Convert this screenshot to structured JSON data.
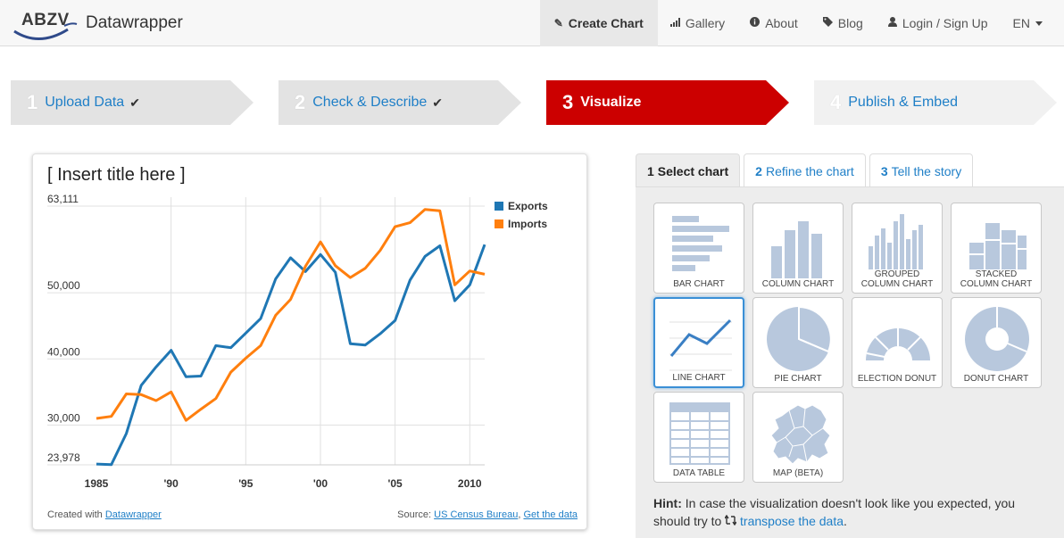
{
  "brand": {
    "logo_text": "ABZV",
    "name": "Datawrapper"
  },
  "nav": {
    "create_chart": "Create Chart",
    "gallery": "Gallery",
    "about": "About",
    "blog": "Blog",
    "login": "Login / Sign Up",
    "lang": "EN"
  },
  "steps": [
    {
      "num": "1",
      "label": "Upload Data",
      "state": "done"
    },
    {
      "num": "2",
      "label": "Check & Describe",
      "state": "done"
    },
    {
      "num": "3",
      "label": "Visualize",
      "state": "active"
    },
    {
      "num": "4",
      "label": "Publish & Embed",
      "state": "todo"
    }
  ],
  "check_mark": "✔",
  "chart": {
    "title": "[ Insert title here ]",
    "footer_prefix": "Created with",
    "footer_link": "Datawrapper",
    "source_prefix": "Source:",
    "source_link": "US Census Bureau",
    "source_sep": ",",
    "get_data": "Get the data"
  },
  "chart_data": {
    "type": "line",
    "title": "[ Insert title here ]",
    "xlabel": "",
    "ylabel": "",
    "x": [
      1985,
      1986,
      1987,
      1988,
      1989,
      1990,
      1991,
      1992,
      1993,
      1994,
      1995,
      1996,
      1997,
      1998,
      1999,
      2000,
      2001,
      2002,
      2003,
      2004,
      2005,
      2006,
      2007,
      2008,
      2009,
      2010,
      2011
    ],
    "xticks": [
      {
        "value": 1985,
        "label": "1985"
      },
      {
        "value": 1990,
        "label": "'90"
      },
      {
        "value": 1995,
        "label": "'95"
      },
      {
        "value": 2000,
        "label": "'00"
      },
      {
        "value": 2005,
        "label": "'05"
      },
      {
        "value": 2010,
        "label": "2010"
      }
    ],
    "yticks": [
      {
        "value": 63111,
        "label": "63,111"
      },
      {
        "value": 50000,
        "label": "50,000"
      },
      {
        "value": 40000,
        "label": "40,000"
      },
      {
        "value": 30000,
        "label": "30,000"
      },
      {
        "value": 23978,
        "label": "23,978"
      }
    ],
    "ylim": [
      23978,
      63111
    ],
    "xlim": [
      1985,
      2011
    ],
    "grid": true,
    "legend_position": "top-right",
    "series": [
      {
        "name": "Exports",
        "color": "#1f77b4",
        "values": [
          24100,
          24000,
          28700,
          36000,
          38800,
          41300,
          37300,
          37400,
          42000,
          41700,
          43900,
          46100,
          52100,
          55300,
          53200,
          55800,
          53100,
          42300,
          42100,
          43800,
          45800,
          51900,
          55500,
          57100,
          48800,
          51200,
          57300
        ]
      },
      {
        "name": "Imports",
        "color": "#ff7f0e",
        "values": [
          31000,
          31300,
          34700,
          34600,
          33700,
          35000,
          30700,
          32400,
          34000,
          38000,
          40100,
          42000,
          46600,
          49000,
          54000,
          57700,
          54100,
          52300,
          53700,
          56400,
          60000,
          60600,
          62600,
          62400,
          51200,
          53300,
          52800
        ]
      }
    ]
  },
  "tabs": [
    {
      "num": "1",
      "label": "Select chart"
    },
    {
      "num": "2",
      "label": "Refine the chart"
    },
    {
      "num": "3",
      "label": "Tell the story"
    }
  ],
  "chart_types": [
    {
      "label": "BAR CHART",
      "icon": "bar-chart-icon"
    },
    {
      "label": "COLUMN CHART",
      "icon": "column-chart-icon"
    },
    {
      "label": "GROUPED\nCOLUMN CHART",
      "icon": "grouped-column-chart-icon"
    },
    {
      "label": "STACKED\nCOLUMN CHART",
      "icon": "stacked-column-chart-icon"
    },
    {
      "label": "LINE CHART",
      "icon": "line-chart-icon",
      "selected": true
    },
    {
      "label": "PIE CHART",
      "icon": "pie-chart-icon"
    },
    {
      "label": "ELECTION DONUT",
      "icon": "election-donut-icon"
    },
    {
      "label": "DONUT CHART",
      "icon": "donut-chart-icon"
    },
    {
      "label": "DATA TABLE",
      "icon": "data-table-icon"
    },
    {
      "label": "MAP (BETA)",
      "icon": "map-icon"
    }
  ],
  "hint": {
    "label": "Hint:",
    "text": "In case the visualization doesn't look like you expected, you should try to",
    "link": "transpose the data",
    "end": "."
  },
  "colors": {
    "accent": "#cc0000",
    "link": "#1f7fc7",
    "icon": "#b8c8dd",
    "exports": "#1f77b4",
    "imports": "#ff7f0e"
  }
}
